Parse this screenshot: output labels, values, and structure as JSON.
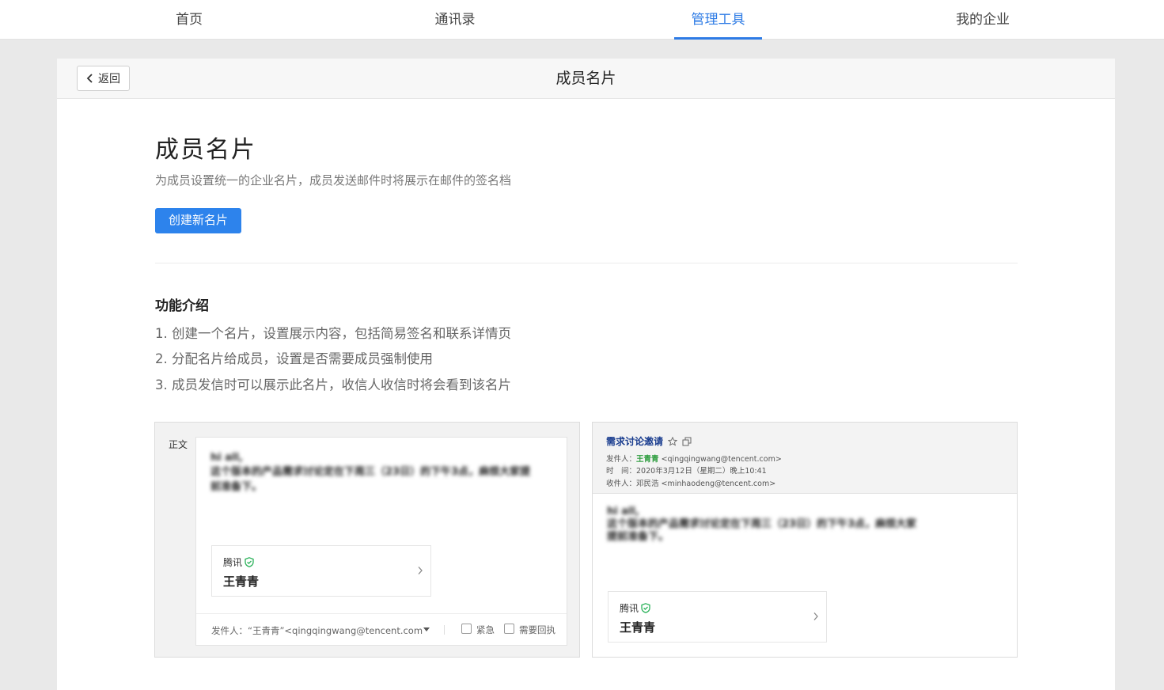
{
  "nav": {
    "items": [
      {
        "label": "首页"
      },
      {
        "label": "通讯录"
      },
      {
        "label": "管理工具"
      },
      {
        "label": "我的企业"
      }
    ],
    "active_index": 2
  },
  "header": {
    "back_label": "返回",
    "title": "成员名片"
  },
  "main": {
    "heading": "成员名片",
    "description": "为成员设置统一的企业名片，成员发送邮件时将展示在邮件的签名档",
    "create_button": "创建新名片",
    "features_title": "功能介绍",
    "features": [
      "1. 创建一个名片，设置展示内容，包括简易签名和联系详情页",
      "2. 分配名片给成员，设置是否需要成员强制使用",
      "3. 成员发信时可以展示此名片，收信人收信时将会看到该名片"
    ]
  },
  "preview_compose": {
    "body_label": "正文",
    "blurred_lines": [
      "hi all,",
      "这个版本的产品需求讨论定在下周三（23日）的下午3点，麻烦大家提",
      "前准备下。"
    ],
    "card_company": "腾讯",
    "card_name": "王青青",
    "from_text": "发件人：“王青青”<qingqingwang@tencent.com",
    "urgent_label": "紧急",
    "receipt_label": "需要回执"
  },
  "preview_read": {
    "subject": "需求讨论邀请",
    "from_label": "发件人：",
    "from_name": "王青青",
    "from_email": "<qingqingwang@tencent.com>",
    "time_label": "时　间：",
    "time_value": "2020年3月12日（星期二）晚上10:41",
    "to_label": "收件人：",
    "to_value": "邓民浩 <minhaodeng@tencent.com>",
    "blurred_lines": [
      "hi all,",
      "这个版本的产品需求讨论定在下周三（23日）的下午3点，麻烦大家",
      "提前准备下。"
    ],
    "card_company": "腾讯",
    "card_name": "王青青"
  },
  "colors": {
    "accent": "#2d7be5",
    "button": "#2d83ec",
    "verified": "#2bb25a"
  }
}
